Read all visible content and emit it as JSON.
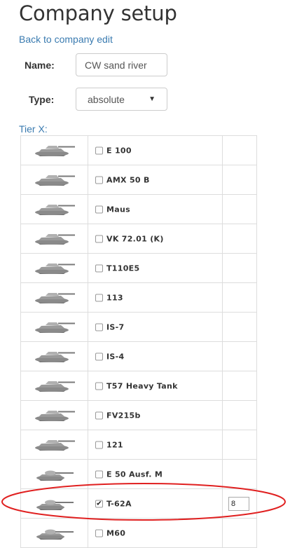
{
  "page": {
    "title": "Company setup",
    "back_link": "Back to company edit"
  },
  "form": {
    "name_label": "Name:",
    "name_value": "CW sand river",
    "type_label": "Type:",
    "type_value": "absolute"
  },
  "tier_label": "Tier X:",
  "tanks": [
    {
      "name": "E 100",
      "checked": false,
      "icon": "heavy-tank-icon"
    },
    {
      "name": "AMX 50 B",
      "checked": false,
      "icon": "heavy-tank-icon"
    },
    {
      "name": "Maus",
      "checked": false,
      "icon": "heavy-tank-icon"
    },
    {
      "name": "VK 72.01 (K)",
      "checked": false,
      "icon": "heavy-tank-icon"
    },
    {
      "name": "T110E5",
      "checked": false,
      "icon": "heavy-tank-icon"
    },
    {
      "name": "113",
      "checked": false,
      "icon": "heavy-tank-icon"
    },
    {
      "name": "IS-7",
      "checked": false,
      "icon": "heavy-tank-icon"
    },
    {
      "name": "IS-4",
      "checked": false,
      "icon": "heavy-tank-icon"
    },
    {
      "name": "T57 Heavy Tank",
      "checked": false,
      "icon": "heavy-tank-icon"
    },
    {
      "name": "FV215b",
      "checked": false,
      "icon": "heavy-tank-icon"
    },
    {
      "name": "121",
      "checked": false,
      "icon": "heavy-tank-icon"
    },
    {
      "name": "E 50 Ausf. M",
      "checked": false,
      "icon": "medium-tank-icon"
    },
    {
      "name": "T-62A",
      "checked": true,
      "icon": "medium-tank-icon",
      "count": "8"
    },
    {
      "name": "M60",
      "checked": false,
      "icon": "medium-tank-icon"
    }
  ],
  "colors": {
    "link": "#3a7bb0",
    "highlight": "#e02020",
    "border": "#dddddd"
  }
}
